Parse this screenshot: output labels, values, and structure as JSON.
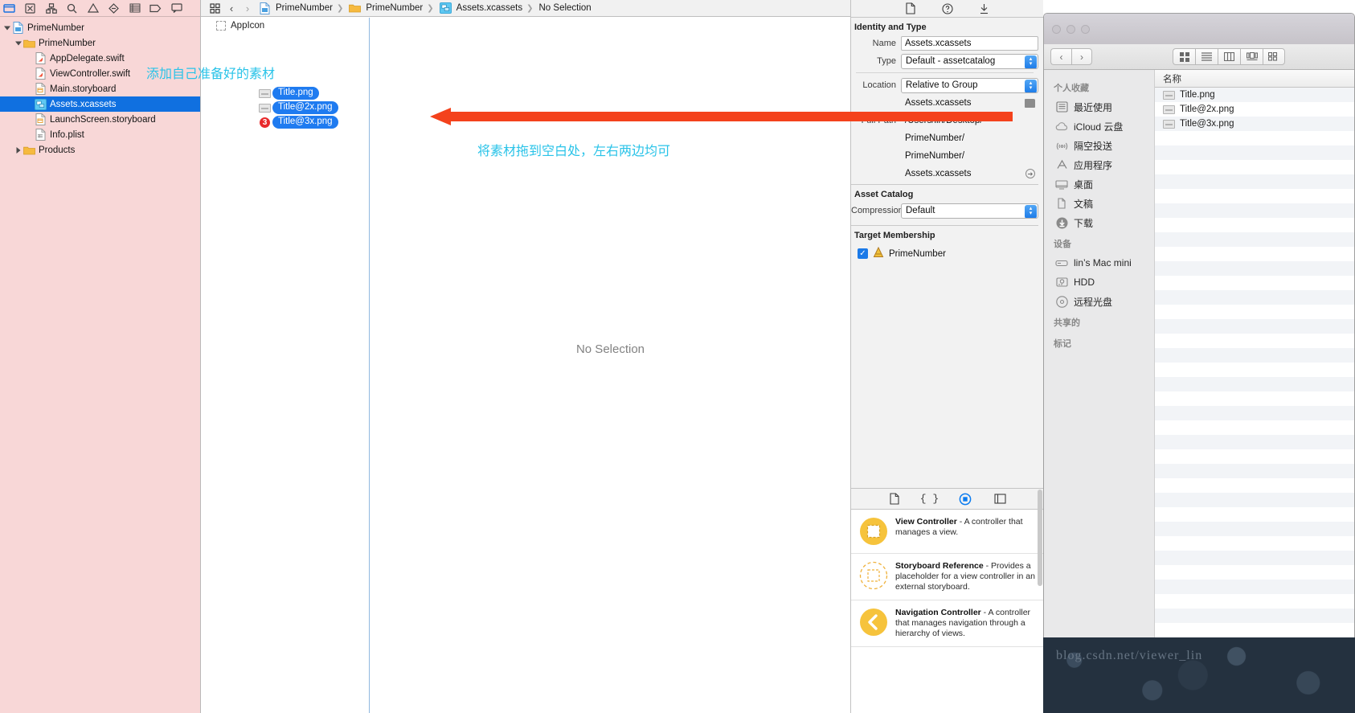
{
  "xcode": {
    "navigator": {
      "toolbar_icons": [
        "folder-icon",
        "warning-square-icon",
        "hierarchy-icon",
        "search-icon",
        "warning-triangle-icon",
        "no-entry-icon",
        "list-icon",
        "tag-icon",
        "comment-icon"
      ],
      "tree": [
        {
          "label": "PrimeNumber",
          "depth": 0,
          "icon": "project-icon",
          "twisty": "down",
          "selected": false
        },
        {
          "label": "PrimeNumber",
          "depth": 1,
          "icon": "folder-icon",
          "twisty": "down",
          "selected": false
        },
        {
          "label": "AppDelegate.swift",
          "depth": 2,
          "icon": "swift-file-icon",
          "twisty": "",
          "selected": false
        },
        {
          "label": "ViewController.swift",
          "depth": 2,
          "icon": "swift-file-icon",
          "twisty": "",
          "selected": false
        },
        {
          "label": "Main.storyboard",
          "depth": 2,
          "icon": "storyboard-file-icon",
          "twisty": "",
          "selected": false
        },
        {
          "label": "Assets.xcassets",
          "depth": 2,
          "icon": "xcassets-icon",
          "twisty": "",
          "selected": true
        },
        {
          "label": "LaunchScreen.storyboard",
          "depth": 2,
          "icon": "storyboard-file-icon",
          "twisty": "",
          "selected": false
        },
        {
          "label": "Info.plist",
          "depth": 2,
          "icon": "plist-file-icon",
          "twisty": "",
          "selected": false
        },
        {
          "label": "Products",
          "depth": 1,
          "icon": "folder-icon",
          "twisty": "right",
          "selected": false
        }
      ]
    },
    "jump_bar": {
      "back_label": "‹",
      "forward_label": "›",
      "crumbs": [
        {
          "label": "PrimeNumber",
          "icon": "project-icon"
        },
        {
          "label": "PrimeNumber",
          "icon": "folder-icon"
        },
        {
          "label": "Assets.xcassets",
          "icon": "xcassets-icon"
        },
        {
          "label": "No Selection",
          "icon": ""
        }
      ]
    },
    "asset_list": {
      "items": [
        {
          "label": "AppIcon",
          "icon": "appicon-placeholder-icon"
        }
      ]
    },
    "canvas": {
      "empty_text": "No Selection"
    },
    "drag_items": [
      {
        "label": "Title.png",
        "badge": ""
      },
      {
        "label": "Title@2x.png",
        "badge": ""
      },
      {
        "label": "Title@3x.png",
        "badge": "3"
      }
    ],
    "annotations": [
      {
        "id": "annot-1",
        "text": "添加自己准备好的素材"
      },
      {
        "id": "annot-2",
        "text": "将素材拖到空白处，左右两边均可"
      }
    ]
  },
  "inspector": {
    "toolbar_icons": [
      "file-inspector-icon",
      "quick-help-icon",
      "pin-icon"
    ],
    "identity": {
      "title": "Identity and Type",
      "name_label": "Name",
      "name_value": "Assets.xcassets",
      "type_label": "Type",
      "type_value": "Default - assetcatalog",
      "location_label": "Location",
      "location_value": "Relative to Group",
      "location_file": "Assets.xcassets",
      "full_path_label": "Full Path",
      "full_path_lines": [
        "/Users/lin/Desktop/",
        "PrimeNumber/",
        "PrimeNumber/",
        "Assets.xcassets"
      ]
    },
    "asset_catalog": {
      "title": "Asset Catalog",
      "compression_label": "Compression",
      "compression_value": "Default"
    },
    "target_membership": {
      "title": "Target Membership",
      "targets": [
        {
          "label": "PrimeNumber",
          "checked": true
        }
      ]
    },
    "library": {
      "tabs": [
        "file-template-library-icon",
        "code-snippet-library-icon",
        "object-library-icon",
        "media-library-icon"
      ],
      "active_tab_index": 2,
      "items": [
        {
          "title": "View Controller",
          "desc": " - A controller that manages a view.",
          "icon": "view-controller-icon"
        },
        {
          "title": "Storyboard Reference",
          "desc": " - Provides a placeholder for a view controller in an external storyboard.",
          "icon": "storyboard-reference-icon"
        },
        {
          "title": "Navigation Controller",
          "desc": " - A controller that manages navigation through a hierarchy of views.",
          "icon": "navigation-controller-icon"
        }
      ]
    }
  },
  "finder": {
    "window_controls": [
      "close-button",
      "minimize-button",
      "zoom-button"
    ],
    "nav_back": "‹",
    "nav_forward": "›",
    "view_buttons": [
      "icon-view-icon",
      "list-view-icon",
      "column-view-icon",
      "cover-flow-icon",
      "arrange-icon"
    ],
    "sidebar": {
      "groups": [
        {
          "title": "个人收藏",
          "items": [
            {
              "label": "最近使用",
              "icon": "recents-icon"
            },
            {
              "label": "iCloud 云盘",
              "icon": "icloud-icon"
            },
            {
              "label": "隔空投送",
              "icon": "airdrop-icon"
            },
            {
              "label": "应用程序",
              "icon": "applications-icon"
            },
            {
              "label": "桌面",
              "icon": "desktop-icon"
            },
            {
              "label": "文稿",
              "icon": "documents-icon"
            },
            {
              "label": "下载",
              "icon": "downloads-icon"
            }
          ]
        },
        {
          "title": "设备",
          "items": [
            {
              "label": "lin’s Mac mini",
              "icon": "computer-icon"
            },
            {
              "label": "HDD",
              "icon": "harddisk-icon"
            },
            {
              "label": "远程光盘",
              "icon": "remote-disc-icon"
            }
          ]
        },
        {
          "title": "共享的",
          "items": []
        },
        {
          "title": "标记",
          "items": []
        }
      ]
    },
    "column_header": "名称",
    "files": [
      "Title.png",
      "Title@2x.png",
      "Title@3x.png"
    ]
  },
  "watermark": {
    "text": "blog.csdn.net/viewer_lin"
  },
  "colors": {
    "selection_blue": "#1070e0",
    "drag_pill_blue": "#1f7bf0",
    "badge_red": "#e8292b",
    "annotation_cyan": "#29c3e8",
    "arrow_red": "#f4421c",
    "navigator_tint": "#f8d7d7"
  }
}
